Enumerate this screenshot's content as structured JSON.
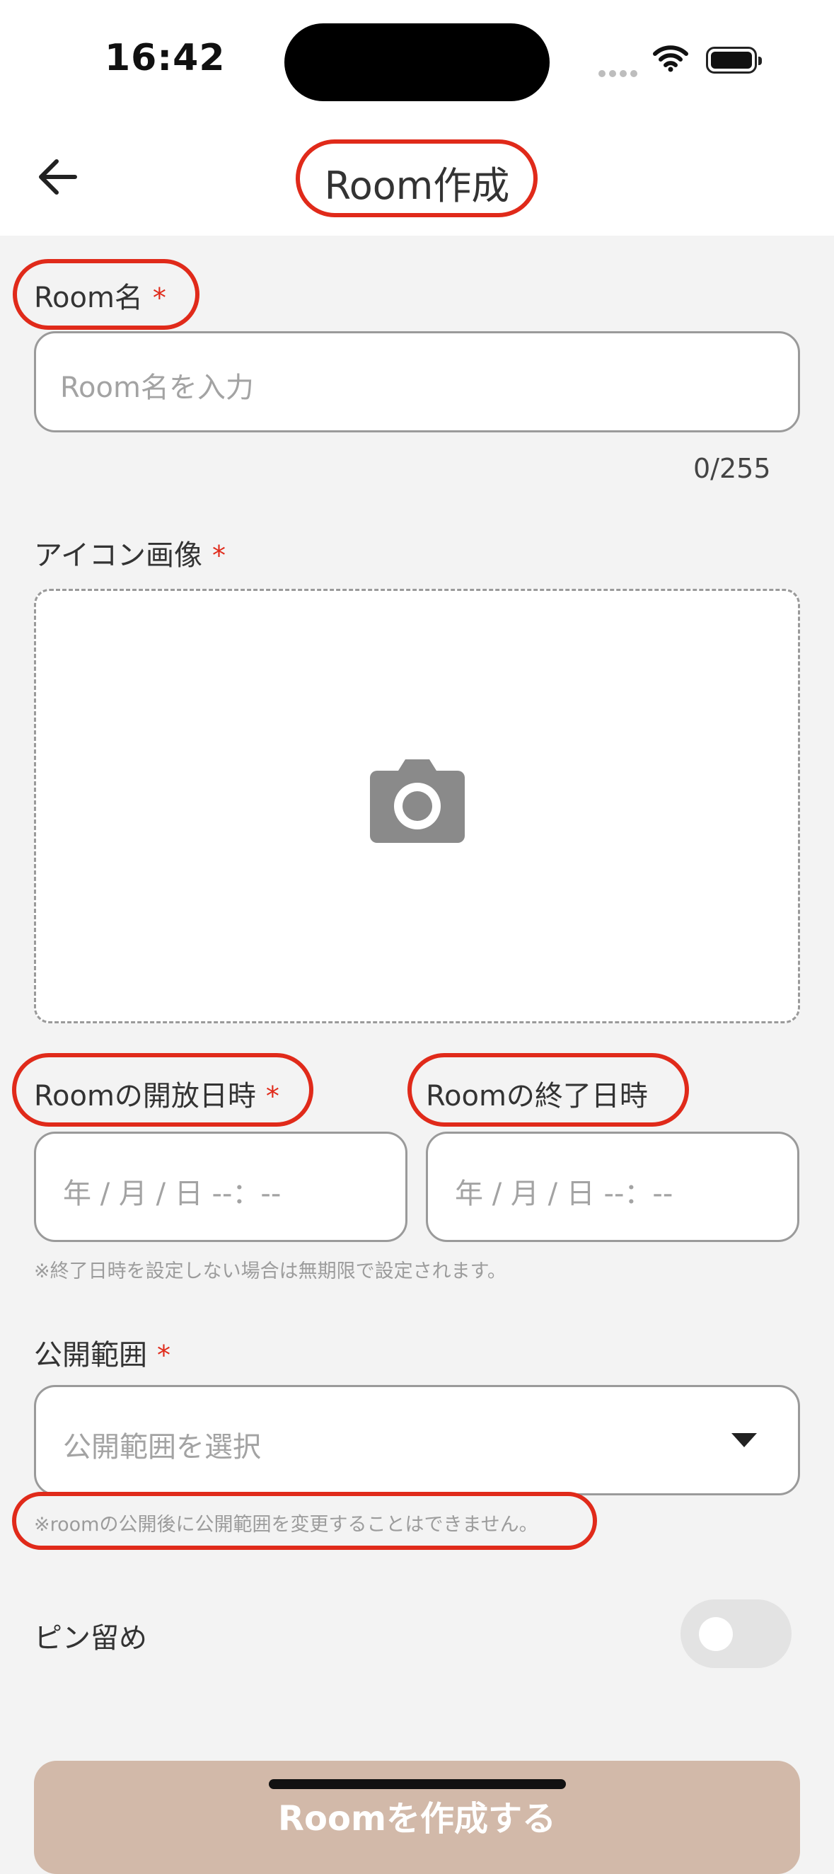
{
  "status_bar": {
    "time": "16:42",
    "signal_icon": "cellular-signal-icon",
    "wifi_icon": "wifi-icon",
    "battery_icon": "battery-icon"
  },
  "header": {
    "title": "Room作成",
    "back_icon": "arrow-left-icon"
  },
  "room_name": {
    "label": "Room名",
    "required_mark": "*",
    "placeholder": "Room名を入力",
    "value": "",
    "counter": "0/255"
  },
  "icon_image": {
    "label": "アイコン画像",
    "required_mark": "*",
    "camera_icon": "camera-icon"
  },
  "open_datetime": {
    "label": "Roomの開放日時",
    "required_mark": "*",
    "placeholder": "年 / 月 / 日 --：--"
  },
  "end_datetime": {
    "label": "Roomの終了日時",
    "placeholder": "年 / 月 / 日 --：--"
  },
  "end_hint": "※終了日時を設定しない場合は無期限で設定されます。",
  "visibility": {
    "label": "公開範囲",
    "required_mark": "*",
    "placeholder": "公開範囲を選択",
    "dropdown_icon": "caret-down-icon",
    "hint": "※roomの公開後に公開範囲を変更することはできません。"
  },
  "pin": {
    "label": "ピン留め",
    "enabled": false
  },
  "submit": {
    "label": "Roomを作成する"
  },
  "colors": {
    "accent_red": "#e02a1a",
    "button_bg": "#d2b9a9",
    "page_bg": "#f3f3f3"
  }
}
